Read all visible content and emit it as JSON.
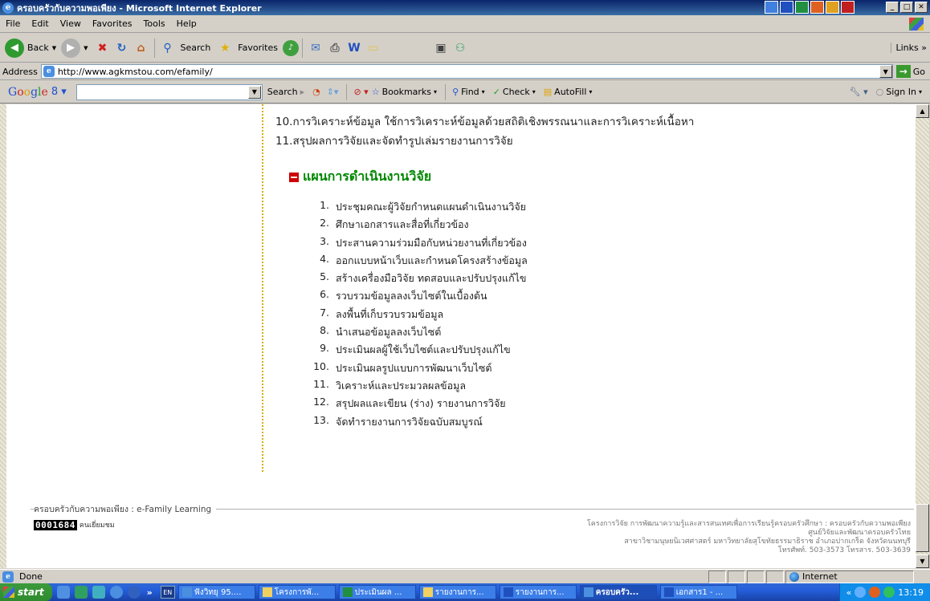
{
  "window": {
    "title": "ครอบครัวกับความพอเพียง - Microsoft Internet Explorer",
    "logo_glyph": "e"
  },
  "menu": [
    "File",
    "Edit",
    "View",
    "Favorites",
    "Tools",
    "Help"
  ],
  "toolbar": {
    "back": "Back",
    "search": "Search",
    "favorites": "Favorites",
    "links": "Links",
    "links_chevron": "»"
  },
  "address": {
    "label": "Address",
    "url": "http://www.agkmstou.com/efamily/",
    "go": "Go"
  },
  "google_toolbar": {
    "logo": "Google",
    "logo_badge": "8",
    "search": "Search",
    "bookmarks": "Bookmarks",
    "find": "Find",
    "check": "Check",
    "autofill": "AutoFill",
    "sign_in": "Sign In"
  },
  "page": {
    "pre_items": [
      "10.การวิเคราะห์ข้อมูล ใช้การวิเคราะห์ข้อมูลด้วยสถิติเชิงพรรณนาและการวิเคราะห์เนื้อหา",
      "11.สรุปผลการวิจัยและจัดทำรูปเล่มรายงานการวิจัย"
    ],
    "section_title": "แผนการดำเนินงานวิจัย",
    "plan_items": [
      {
        "num": "1.",
        "text": "ประชุมคณะผู้วิจัยกำหนดแผนดำเนินงานวิจัย"
      },
      {
        "num": "2.",
        "text": "ศึกษาเอกสารและสื่อที่เกี่ยวข้อง"
      },
      {
        "num": "3.",
        "text": "ประสานความร่วมมือกับหน่วยงานที่เกี่ยวข้อง"
      },
      {
        "num": "4.",
        "text": "ออกแบบหน้าเว็บและกำหนดโครงสร้างข้อมูล"
      },
      {
        "num": "5.",
        "text": "สร้างเครื่องมือวิจัย ทดสอบและปรับปรุงแก้ไข"
      },
      {
        "num": "6.",
        "text": "รวบรวมข้อมูลลงเว็บไซต์ในเบื้องต้น"
      },
      {
        "num": "7.",
        "text": "ลงพื้นที่เก็บรวบรวมข้อมูล"
      },
      {
        "num": "8.",
        "text": "นำเสนอข้อมูลลงเว็บไซต์"
      },
      {
        "num": "9.",
        "text": "ประเมินผลผู้ใช้เว็บไซต์และปรับปรุงแก้ไข"
      },
      {
        "num": "10.",
        "text": "ประเมินผลรูปแบบการพัฒนาเว็บไซต์"
      },
      {
        "num": "11.",
        "text": "วิเคราะห์และประมวลผลข้อมูล"
      },
      {
        "num": "12.",
        "text": "สรุปผลและเขียน (ร่าง) รายงานการวิจัย"
      },
      {
        "num": "13.",
        "text": "จัดทำรายงานการวิจัยฉบับสมบูรณ์"
      }
    ],
    "footer": {
      "brand": "ครอบครัวกับความพอเพียง : e-Family Learning",
      "counter": "0001684",
      "counter_label": "คนเยี่ยมชม",
      "right_lines": [
        "โครงการวิจัย การพัฒนาความรู้และสารสนเทศเพื่อการเรียนรู้ครอบครัวศึกษา : ครอบครัวกับความพอเพียง",
        "ศูนย์วิจัยและพัฒนาครอบครัวไทย",
        "สาขาวิชามนุษยนิเวศศาสตร์ มหาวิทยาลัยสุโขทัยธรรมาธิราช อำเภอปากเกร็ด จังหวัดนนทบุรี",
        "โทรศัพท์. 503-3573   โทรสาร. 503-3639"
      ]
    }
  },
  "status": {
    "text": "Done",
    "zone": "Internet"
  },
  "taskbar": {
    "start": "start",
    "chevron": "»",
    "lang": "EN",
    "tasks": [
      "ฟังวิทยุ 95....",
      "โครงการพั...",
      "ประเมินผล ...",
      "รายงานการ...",
      "รายงานการ...",
      "ครอบครัว...",
      "เอกสาร1 - ..."
    ],
    "tray_chevron": "«",
    "clock": "13:19"
  },
  "colors": {
    "section_title": "#008800",
    "section_bullet": "#cc0000",
    "divider_dots": "#d4b000",
    "titlebar": "#0a246a",
    "taskbar": "#245edb"
  }
}
